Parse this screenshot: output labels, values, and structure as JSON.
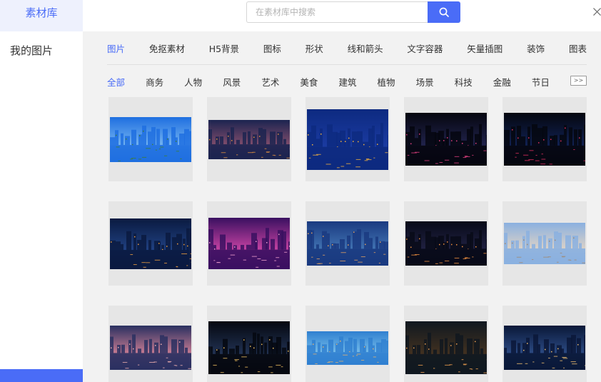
{
  "sidebar": {
    "active_label": "素材库",
    "my_images_label": "我的图片"
  },
  "search": {
    "placeholder": "在素材库中搜索",
    "value": ""
  },
  "tabs": [
    {
      "label": "图片",
      "active": true
    },
    {
      "label": "免抠素材",
      "active": false
    },
    {
      "label": "H5背景",
      "active": false
    },
    {
      "label": "图标",
      "active": false
    },
    {
      "label": "形状",
      "active": false
    },
    {
      "label": "线和箭头",
      "active": false
    },
    {
      "label": "文字容器",
      "active": false
    },
    {
      "label": "矢量插图",
      "active": false
    },
    {
      "label": "装饰",
      "active": false
    },
    {
      "label": "图表",
      "active": false
    }
  ],
  "categories": [
    {
      "label": "全部",
      "active": true
    },
    {
      "label": "商务",
      "active": false
    },
    {
      "label": "人物",
      "active": false
    },
    {
      "label": "风景",
      "active": false
    },
    {
      "label": "艺术",
      "active": false
    },
    {
      "label": "美食",
      "active": false
    },
    {
      "label": "建筑",
      "active": false
    },
    {
      "label": "植物",
      "active": false
    },
    {
      "label": "场景",
      "active": false
    },
    {
      "label": "科技",
      "active": false
    },
    {
      "label": "金融",
      "active": false
    },
    {
      "label": "节日",
      "active": false
    }
  ],
  "more_label": ">>",
  "colors": {
    "accent": "#4a6cf7",
    "panel_bg": "#f2f2f2",
    "card_bg": "#e6e6e6"
  },
  "thumbnails": [
    {
      "scene": "eiffel-tower-day",
      "colors": [
        "#1f6fe0",
        "#6fb0f0",
        "#3f7f2f"
      ]
    },
    {
      "scene": "paris-night-aerial",
      "colors": [
        "#1c2450",
        "#7a4a6a",
        "#e09040"
      ]
    },
    {
      "scene": "city-harbor-night",
      "colors": [
        "#0d2a80",
        "#1a3aa0",
        "#f0b040"
      ]
    },
    {
      "scene": "city-light-trails",
      "colors": [
        "#05060f",
        "#20224a",
        "#e04080"
      ]
    },
    {
      "scene": "toronto-skyline-night",
      "colors": [
        "#05070f",
        "#102050",
        "#e03060"
      ]
    },
    {
      "scene": "shanghai-skyline-reflection",
      "colors": [
        "#0a1a40",
        "#1f3f7f",
        "#f0a040"
      ]
    },
    {
      "scene": "shanghai-purple-sunset",
      "colors": [
        "#3a1060",
        "#c040a0",
        "#f0a0d0"
      ]
    },
    {
      "scene": "london-eye-dusk",
      "colors": [
        "#1a3a80",
        "#3f70b0",
        "#e0a060"
      ]
    },
    {
      "scene": "city-night-aerial",
      "colors": [
        "#080a18",
        "#1f2040",
        "#f09040"
      ]
    },
    {
      "scene": "classical-building",
      "colors": [
        "#8ab0e0",
        "#d8d0c8",
        "#a08870"
      ]
    },
    {
      "scene": "shanghai-pink-dusk",
      "colors": [
        "#2a3060",
        "#c07890",
        "#f0b0b0"
      ]
    },
    {
      "scene": "waterfront-towers-night",
      "colors": [
        "#050810",
        "#203050",
        "#f0c060"
      ]
    },
    {
      "scene": "venice-canal-day",
      "colors": [
        "#3080d0",
        "#70b8e8",
        "#e0b070"
      ]
    },
    {
      "scene": "canal-street-night",
      "colors": [
        "#101820",
        "#403020",
        "#f0a050"
      ]
    },
    {
      "scene": "city-highway-trails",
      "colors": [
        "#0a1838",
        "#2a4880",
        "#f0c070"
      ]
    }
  ]
}
